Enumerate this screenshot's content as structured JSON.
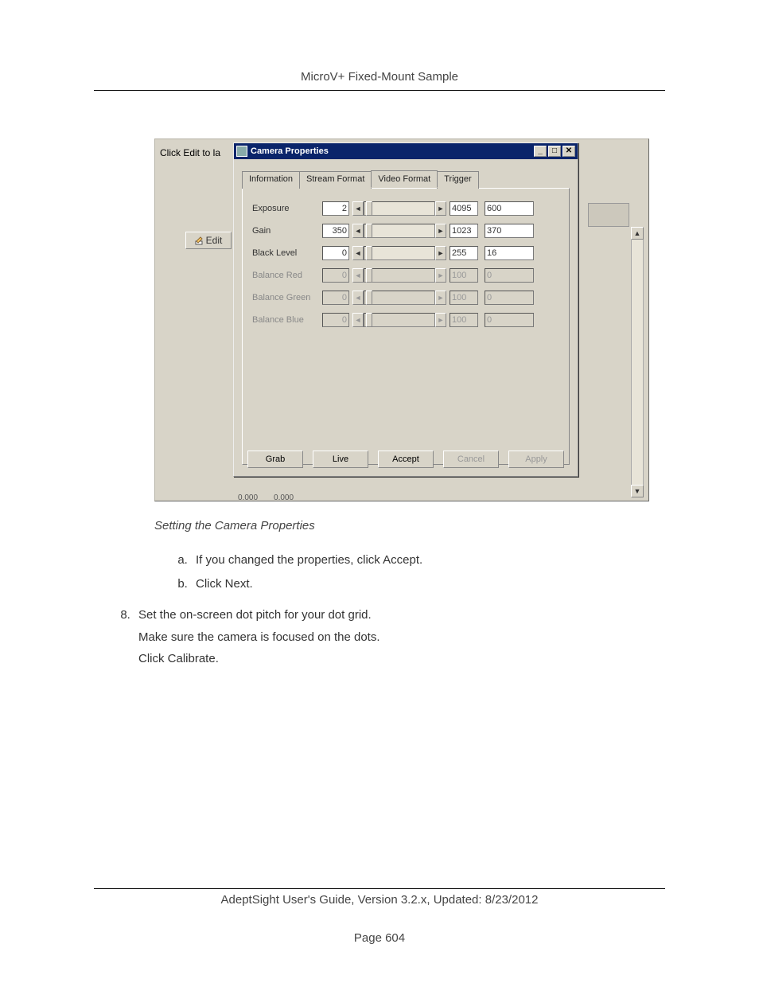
{
  "header": {
    "title": "MicroV+ Fixed-Mount Sample"
  },
  "screenshot": {
    "bgText": "Click Edit to la",
    "editBtn": "Edit",
    "dialog": {
      "title": "Camera Properties",
      "tabs": [
        "Information",
        "Stream Format",
        "Video Format",
        "Trigger"
      ],
      "activeTab": 2,
      "properties": [
        {
          "label": "Exposure",
          "min": "2",
          "max": "4095",
          "value": "600",
          "enabled": true
        },
        {
          "label": "Gain",
          "min": "350",
          "max": "1023",
          "value": "370",
          "enabled": true
        },
        {
          "label": "Black Level",
          "min": "0",
          "max": "255",
          "value": "16",
          "enabled": true
        },
        {
          "label": "Balance Red",
          "min": "0",
          "max": "100",
          "value": "0",
          "enabled": false
        },
        {
          "label": "Balance Green",
          "min": "0",
          "max": "100",
          "value": "0",
          "enabled": false
        },
        {
          "label": "Balance Blue",
          "min": "0",
          "max": "100",
          "value": "0",
          "enabled": false
        }
      ],
      "buttons": {
        "grab": "Grab",
        "live": "Live",
        "accept": "Accept",
        "cancel": "Cancel",
        "apply": "Apply"
      },
      "statusValues": [
        "0.000",
        "0.000"
      ]
    }
  },
  "caption": "Setting the Camera Properties",
  "subSteps": {
    "a": "If you changed the properties, click Accept.",
    "b": "Click Next."
  },
  "step8": {
    "num": "8.",
    "line1": "Set the on-screen dot pitch for your dot grid.",
    "line2": "Make sure the camera is focused on the dots.",
    "line3": "Click Calibrate."
  },
  "footer": {
    "line1": "AdeptSight User's Guide,  Version 3.2.x, Updated: 8/23/2012",
    "line2": "Page 604"
  }
}
